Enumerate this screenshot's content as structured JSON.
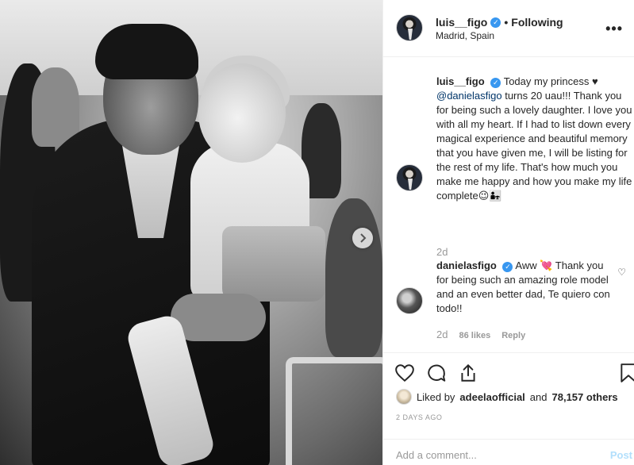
{
  "post": {
    "image_alt": "Black and white photo of a man holding a young girl",
    "next_glyph": "›"
  },
  "header": {
    "username": "luis__figo",
    "verified_glyph": "✓",
    "separator": "•",
    "follow_status": "Following",
    "location": "Madrid, Spain",
    "more_glyph": "•••"
  },
  "caption": {
    "username": "luis__figo",
    "text_1": "Today my princess ♥",
    "mention": "@danielasfigo",
    "text_2": "turns 20 uau!!! Thank you for being such a lovely daughter. I love you with all my heart. If I had to list down every magical experience and beautiful memory that you have given me, I will be listing for the rest of my life. That's how much you make me happy and how you make my life complete😉👨‍👧",
    "time": "2d"
  },
  "comment": {
    "username": "danielasfigo",
    "text": "Aww 💘 Thank you for being such an amazing role model and an even better dad, Te quiero con todo!!",
    "time": "2d",
    "likes": "86 likes",
    "reply": "Reply",
    "heart_glyph": "♡"
  },
  "likes": {
    "prefix": "Liked by",
    "user": "adeelaofficial",
    "and": "and",
    "others": "78,157 others"
  },
  "date": "2 DAYS AGO",
  "add_comment": {
    "placeholder": "Add a comment...",
    "post_label": "Post"
  },
  "colors": {
    "verified": "#3897f0",
    "post_button": "#b2dffc",
    "muted": "#999999"
  }
}
